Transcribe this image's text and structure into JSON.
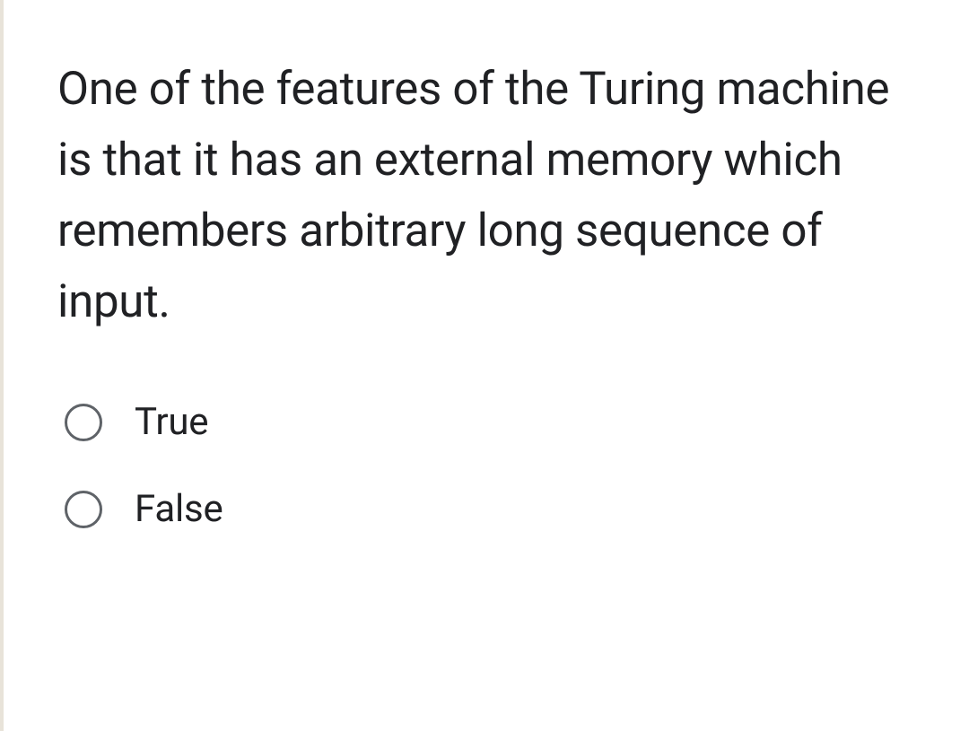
{
  "question": {
    "text": "One of the features of the Turing machine is that it has an external memory which remembers arbitrary long sequence of input."
  },
  "options": [
    {
      "label": "True"
    },
    {
      "label": "False"
    }
  ]
}
